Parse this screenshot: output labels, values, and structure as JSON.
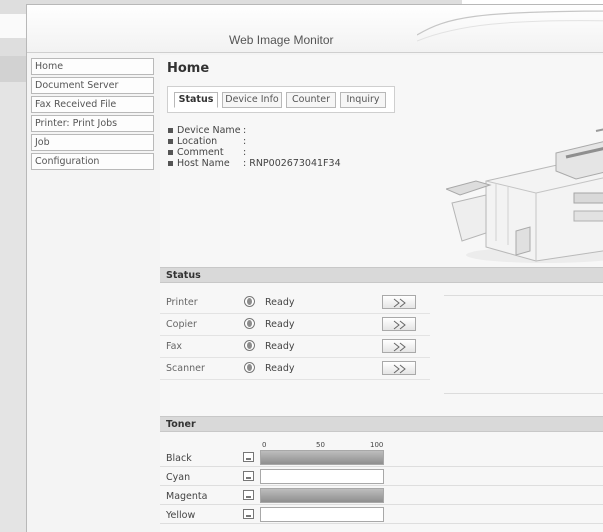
{
  "header": {
    "title": "Web Image Monitor"
  },
  "sidebar": {
    "items": [
      {
        "label": "Home"
      },
      {
        "label": "Document Server"
      },
      {
        "label": "Fax Received File"
      },
      {
        "label": "Printer: Print Jobs"
      },
      {
        "label": "Job"
      },
      {
        "label": "Configuration"
      }
    ]
  },
  "main": {
    "title": "Home",
    "tabs": [
      {
        "label": "Status",
        "active": true
      },
      {
        "label": "Device Info",
        "active": false
      },
      {
        "label": "Counter",
        "active": false
      },
      {
        "label": "Inquiry",
        "active": false
      }
    ],
    "device_info": [
      {
        "label": "Device Name",
        "value": ":"
      },
      {
        "label": "Location",
        "value": ":"
      },
      {
        "label": "Comment",
        "value": ":"
      },
      {
        "label": "Host Name",
        "value": ": RNP002673041F34"
      }
    ]
  },
  "status": {
    "heading": "Status",
    "rows": [
      {
        "label": "Printer",
        "value": "Ready",
        "icon": "status-icon",
        "button_icon": "double-chevron-right-icon"
      },
      {
        "label": "Copier",
        "value": "Ready",
        "icon": "status-icon",
        "button_icon": "double-chevron-right-icon"
      },
      {
        "label": "Fax",
        "value": "Ready",
        "icon": "status-icon",
        "button_icon": "double-chevron-right-icon"
      },
      {
        "label": "Scanner",
        "value": "Ready",
        "icon": "status-icon",
        "button_icon": "double-chevron-right-icon"
      }
    ]
  },
  "toner": {
    "heading": "Toner",
    "scale": [
      "0",
      "50",
      "100"
    ],
    "rows": [
      {
        "label": "Black",
        "level_percent": 100
      },
      {
        "label": "Cyan",
        "level_percent": 0
      },
      {
        "label": "Magenta",
        "level_percent": 100
      },
      {
        "label": "Yellow",
        "level_percent": 0
      }
    ]
  },
  "colors": {
    "section_bar": "#d9d9d9",
    "toner_fill": "#9a9a9a",
    "frame_border": "#b8b8b8"
  }
}
